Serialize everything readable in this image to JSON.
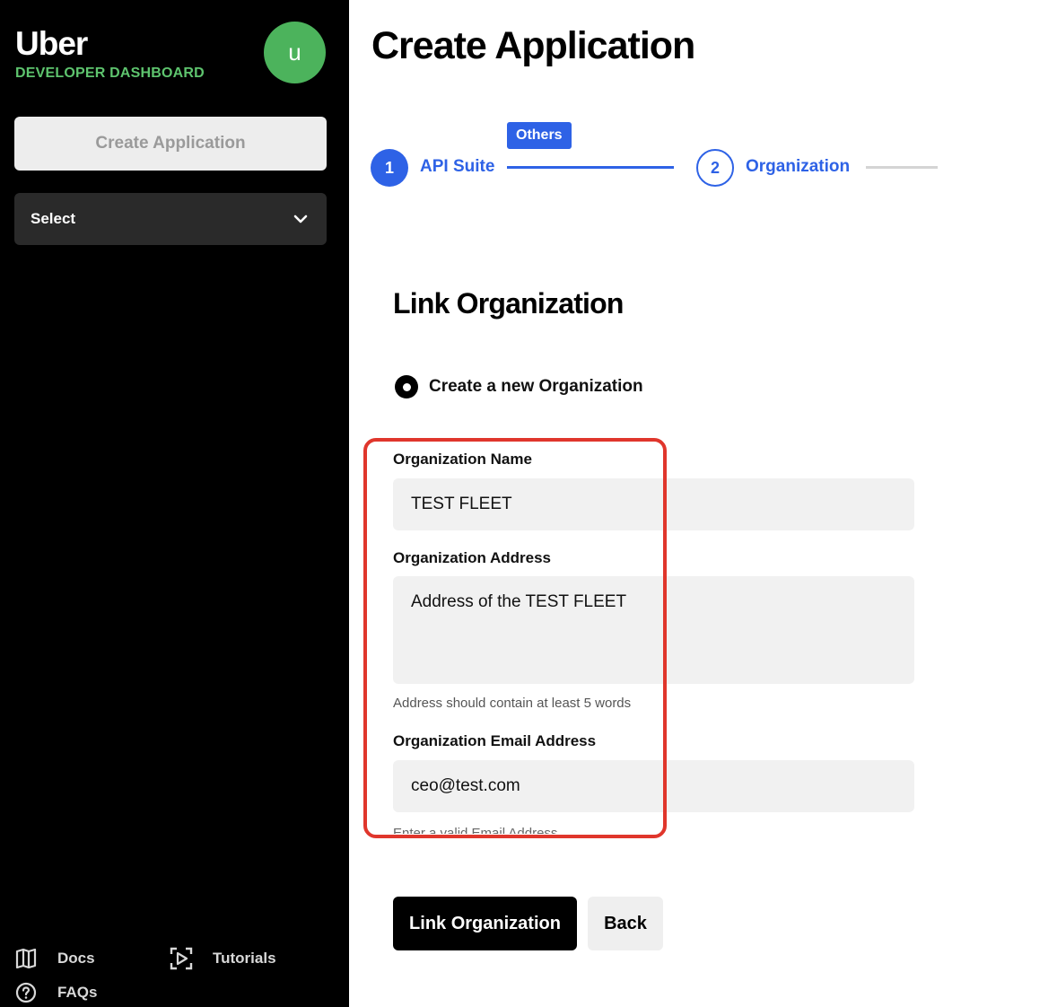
{
  "sidebar": {
    "brand": "Uber",
    "brand_subtitle": "DEVELOPER DASHBOARD",
    "avatar_letter": "u",
    "create_button_label": "Create Application",
    "select_label": "Select",
    "footer": {
      "docs": "Docs",
      "tutorials": "Tutorials",
      "faqs": "FAQs"
    }
  },
  "main": {
    "page_title": "Create Application",
    "stepper": {
      "badge": "Others",
      "steps": [
        {
          "number": "1",
          "label": "API Suite"
        },
        {
          "number": "2",
          "label": "Organization"
        }
      ]
    },
    "section_title": "Link Organization",
    "radio_option": "Create a new Organization",
    "form": {
      "name_label": "Organization Name",
      "name_value": "TEST FLEET",
      "address_label": "Organization Address",
      "address_value": "Address of the TEST FLEET",
      "address_hint": "Address should contain at least 5 words",
      "email_label": "Organization Email Address",
      "email_value": "ceo@test.com",
      "email_hint": "Enter a valid Email Address"
    },
    "buttons": {
      "primary": "Link Organization",
      "secondary": "Back"
    }
  },
  "colors": {
    "accent": "#2e62e6",
    "brand_green": "#5ec46e",
    "highlight": "#e0362c"
  }
}
